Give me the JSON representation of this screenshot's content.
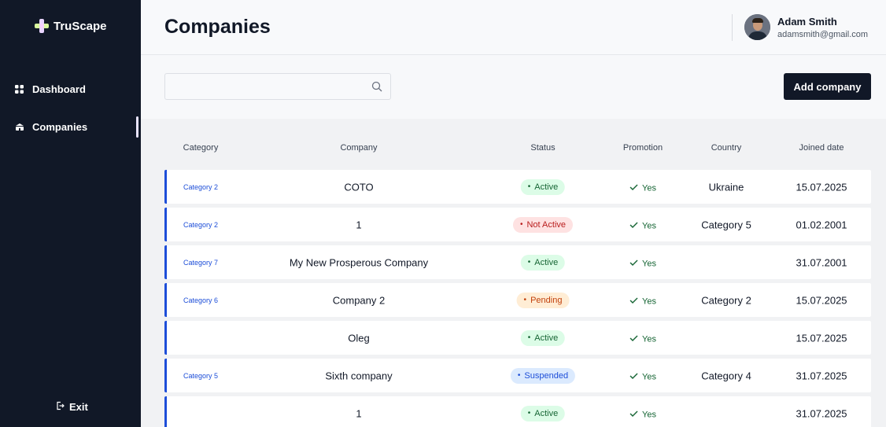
{
  "app": {
    "name": "TruScape"
  },
  "sidebar": {
    "items": [
      {
        "label": "Dashboard",
        "icon": "grid-icon"
      },
      {
        "label": "Companies",
        "icon": "building-icon",
        "active": true
      }
    ],
    "exit_label": "Exit"
  },
  "header": {
    "title": "Companies"
  },
  "user": {
    "name": "Adam Smith",
    "email": "adamsmith@gmail.com"
  },
  "search": {
    "placeholder": "",
    "value": ""
  },
  "actions": {
    "add_label": "Add company"
  },
  "table": {
    "columns": [
      "Category",
      "Company",
      "Status",
      "Promotion",
      "Country",
      "Joined date"
    ],
    "rows": [
      {
        "category": "Category 2",
        "company": "COTO",
        "status": "Active",
        "promotion": "Yes",
        "country": "Ukraine",
        "joined": "15.07.2025"
      },
      {
        "category": "Category 2",
        "company": "1",
        "status": "Not Active",
        "promotion": "Yes",
        "country": "Category 5",
        "joined": "01.02.2001"
      },
      {
        "category": "Category 7",
        "company": "My New Prosperous Company",
        "status": "Active",
        "promotion": "Yes",
        "country": "",
        "joined": "31.07.2001"
      },
      {
        "category": "Category 6",
        "company": "Company 2",
        "status": "Pending",
        "promotion": "Yes",
        "country": "Category 2",
        "joined": "15.07.2025"
      },
      {
        "category": "",
        "company": "Oleg",
        "status": "Active",
        "promotion": "Yes",
        "country": "",
        "joined": "15.07.2025"
      },
      {
        "category": "Category 5",
        "company": "Sixth company",
        "status": "Suspended",
        "promotion": "Yes",
        "country": "Category 4",
        "joined": "31.07.2025"
      },
      {
        "category": "",
        "company": "1",
        "status": "Active",
        "promotion": "Yes",
        "country": "",
        "joined": "31.07.2025"
      }
    ]
  },
  "status_colors": {
    "Active": {
      "bg": "#dcfce7",
      "fg": "#166534"
    },
    "Not Active": {
      "bg": "#fee2e2",
      "fg": "#b91c1c"
    },
    "Pending": {
      "bg": "#ffedd5",
      "fg": "#c2410c"
    },
    "Suspended": {
      "bg": "#dbeafe",
      "fg": "#1d4ed8"
    }
  }
}
